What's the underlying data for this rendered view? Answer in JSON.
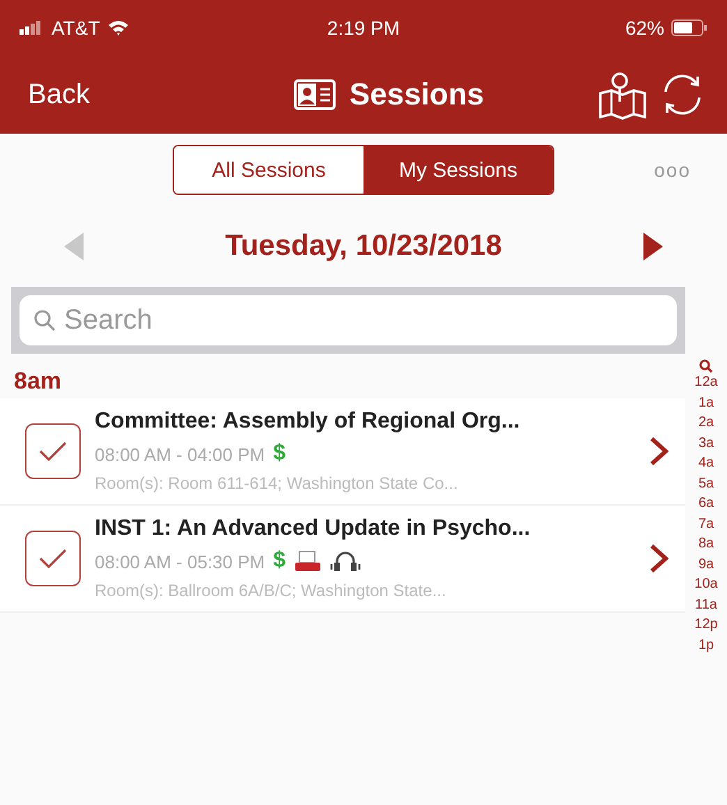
{
  "status_bar": {
    "carrier": "AT&T",
    "time": "2:19 PM",
    "battery": "62%"
  },
  "nav_bar": {
    "back": "Back",
    "title": "Sessions"
  },
  "tabs": [
    {
      "label": "All Sessions",
      "selected": false
    },
    {
      "label": "My Sessions",
      "selected": true
    }
  ],
  "more": "ooo",
  "date_nav": {
    "date": "Tuesday, 10/23/2018",
    "prev_enabled": false,
    "next_enabled": true
  },
  "search": {
    "placeholder": "Search"
  },
  "section": "8am",
  "sessions": [
    {
      "checked": true,
      "title": "Committee: Assembly of Regional Org...",
      "time": "08:00 AM - 04:00 PM",
      "room": "Room(s): Room 611-614; Washington State Co...",
      "badges": [
        {
          "kind": "price",
          "text": "$"
        }
      ]
    },
    {
      "checked": true,
      "title": "INST 1: An Advanced Update in Psycho...",
      "time": "08:00 AM - 05:30 PM",
      "room": "Room(s): Ballroom 6A/B/C; Washington State...",
      "badges": [
        {
          "kind": "price",
          "text": "$"
        },
        {
          "kind": "device"
        },
        {
          "kind": "audio"
        }
      ]
    }
  ],
  "index": [
    "12a",
    "1a",
    "2a",
    "3a",
    "4a",
    "5a",
    "6a",
    "7a",
    "8a",
    "9a",
    "10a",
    "11a",
    "12p",
    "1p"
  ]
}
